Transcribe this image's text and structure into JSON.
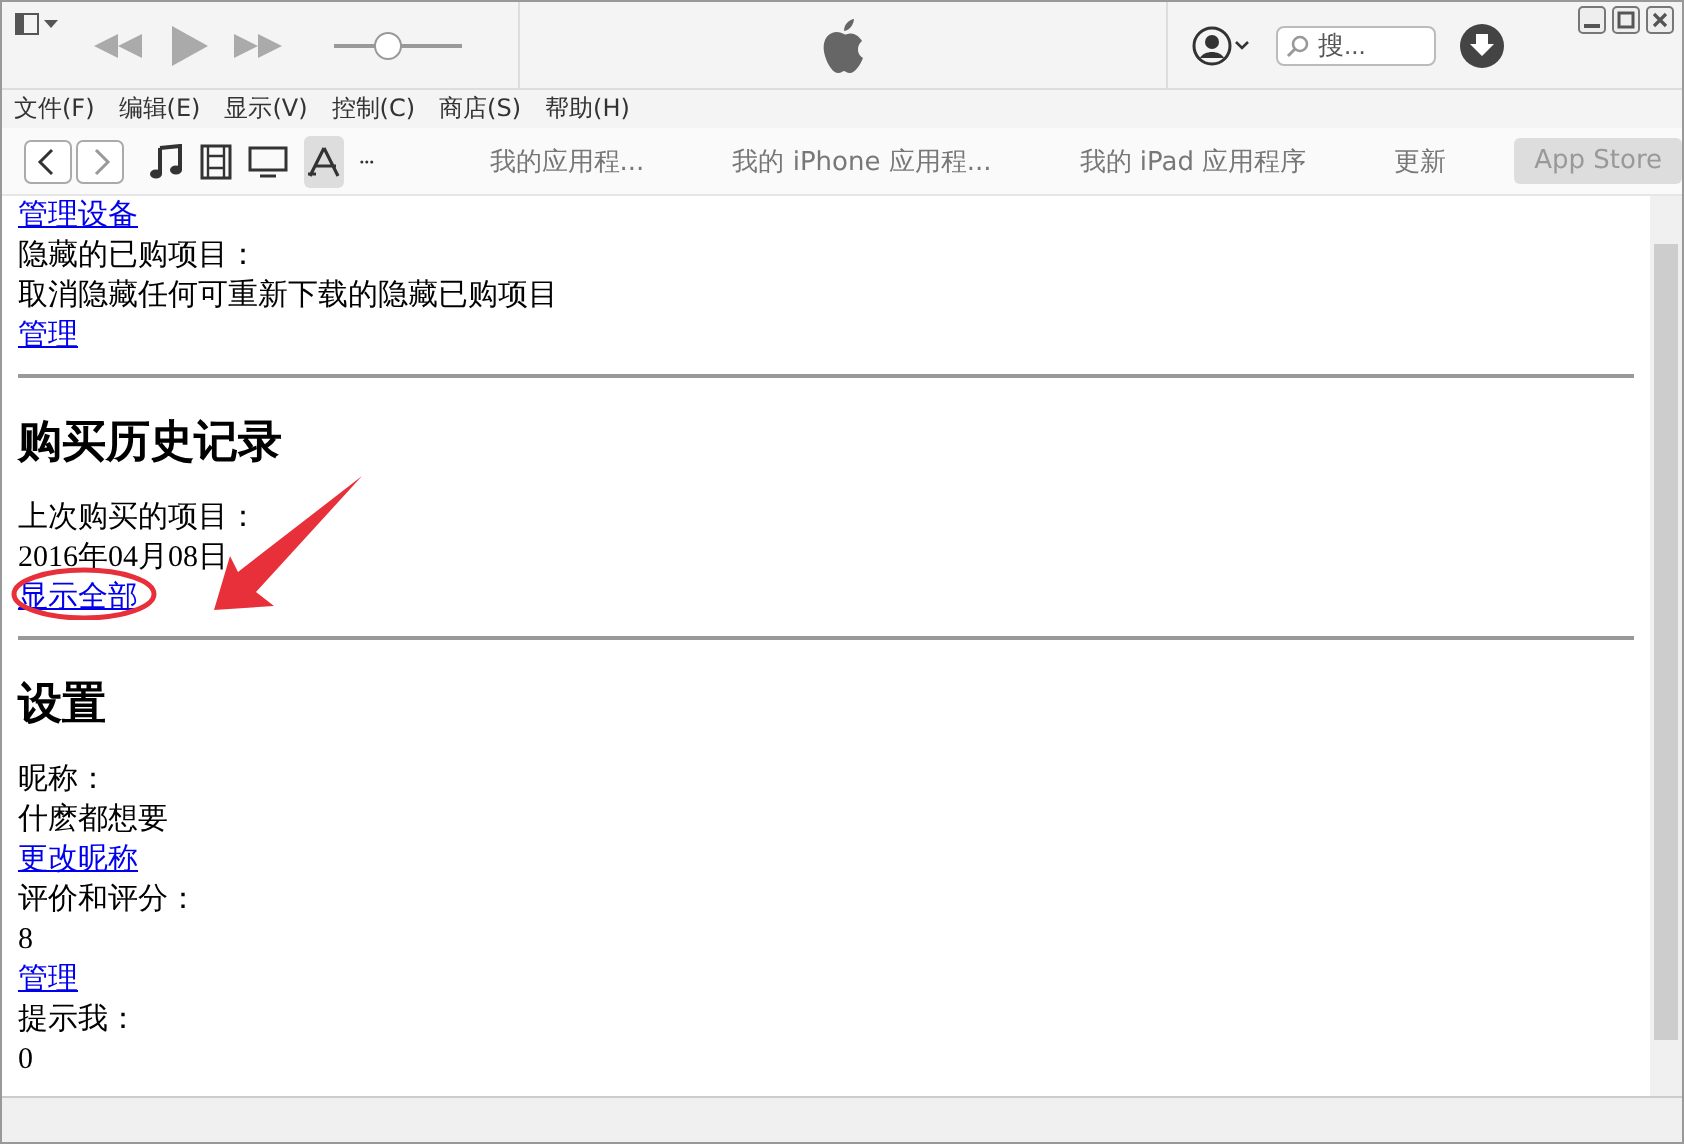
{
  "toolbar": {
    "volume": {
      "level": 0.42
    },
    "search": {
      "placeholder": "搜..."
    }
  },
  "menu_bar": [
    "文件(F)",
    "编辑(E)",
    "显示(V)",
    "控制(C)",
    "商店(S)",
    "帮助(H)"
  ],
  "media_kinds": [
    {
      "kind": "music",
      "selected": false
    },
    {
      "kind": "movies",
      "selected": false
    },
    {
      "kind": "tv",
      "selected": false
    },
    {
      "kind": "apps",
      "selected": true
    }
  ],
  "tabs": [
    {
      "label": "我的应用程...",
      "selected": false
    },
    {
      "label": "我的 iPhone 应用程...",
      "selected": false
    },
    {
      "label": "我的 iPad 应用程序",
      "selected": false
    },
    {
      "label": "更新",
      "selected": false
    },
    {
      "label": "App Store",
      "selected": true
    }
  ],
  "content": [
    {
      "kind": "link",
      "text": "管理设备"
    },
    {
      "kind": "text",
      "text": "隐藏的已购项目："
    },
    {
      "kind": "text",
      "text": "取消隐藏任何可重新下载的隐藏已购项目"
    },
    {
      "kind": "link",
      "text": "管理"
    },
    {
      "kind": "rule"
    },
    {
      "kind": "heading",
      "text": "购买历史记录"
    },
    {
      "kind": "text",
      "text": "上次购买的项目："
    },
    {
      "kind": "text",
      "text": "2016年04月08日"
    },
    {
      "kind": "link",
      "text": "显示全部",
      "highlighted": true
    },
    {
      "kind": "rule"
    },
    {
      "kind": "heading",
      "text": "设置"
    },
    {
      "kind": "text",
      "text": "昵称："
    },
    {
      "kind": "text",
      "text": "什麽都想要"
    },
    {
      "kind": "link",
      "text": "更改昵称"
    },
    {
      "kind": "text",
      "text": "评价和评分："
    },
    {
      "kind": "text",
      "text": "8"
    },
    {
      "kind": "link",
      "text": "管理"
    },
    {
      "kind": "text",
      "text": "提示我："
    },
    {
      "kind": "text",
      "text": "0"
    }
  ]
}
